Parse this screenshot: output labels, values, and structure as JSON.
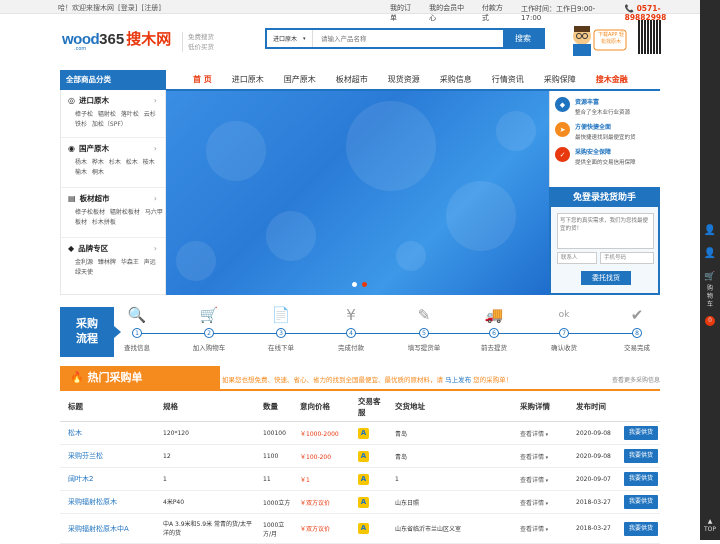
{
  "topbar": {
    "welcome": "哈！欢迎来搜木网",
    "login": "[登录]",
    "register": "[注册]",
    "links": [
      "我的订单",
      "我的会员中心",
      "付款方式",
      "工作时间：工作日9:00-17:00"
    ],
    "phone": "0571-89882998"
  },
  "logo": {
    "text_a": "wood",
    "text_b": "365",
    "text_cn": "搜木网",
    "sub": ".com"
  },
  "slogan": [
    "免费搜货",
    "低价买货"
  ],
  "search": {
    "category": "进口原木",
    "placeholder": "请输入产品名称",
    "button": "搜索"
  },
  "mascot": {
    "text": "下载APP 轻松找原木"
  },
  "nav": {
    "category_header": "全部商品分类",
    "items": [
      "首 页",
      "进口原木",
      "国产原木",
      "板材超市",
      "现货资源",
      "采购信息",
      "行情资讯",
      "采购保障",
      "搜木金融"
    ]
  },
  "categories": [
    {
      "title": "进口原木",
      "subs": "樟子松  辐射松  落叶松  云杉  铁杉  加松（SPF）"
    },
    {
      "title": "国产原木",
      "subs": "杨木  桦木  杉木  松木  桉木  榆木  桐木"
    },
    {
      "title": "板材超市",
      "subs": "樟子松板材  辐射松板材  马六甲板材  杉木拼板"
    },
    {
      "title": "品牌专区",
      "subs": "金利源  臻林牌  华森王  声远  绿天使"
    }
  ],
  "features": [
    {
      "title": "资源丰富",
      "desc": "整合了全木业行业资源",
      "color": "#1f73bf"
    },
    {
      "title": "方便快捷全面",
      "desc": "最快捷速找到最便宜的货",
      "color": "#f58a1f"
    },
    {
      "title": "采购安全保障",
      "desc": "提供全面的交易信用保障",
      "color": "#e8380d"
    }
  ],
  "helper": {
    "title": "免登录找货助手",
    "textarea_placeholder": "写下您的真实需求，我们为您找最便宜的货！",
    "contact_placeholder": "联系人",
    "phone_placeholder": "手机号码",
    "submit": "委托找货"
  },
  "process": {
    "title_a": "采购",
    "title_b": "流程",
    "steps": [
      {
        "n": "1",
        "label": "查找信息",
        "icon": "🔍"
      },
      {
        "n": "2",
        "label": "加入购物车",
        "icon": "🛒"
      },
      {
        "n": "3",
        "label": "在线下单",
        "icon": "📄"
      },
      {
        "n": "4",
        "label": "完成付款",
        "icon": "¥"
      },
      {
        "n": "5",
        "label": "填写提货单",
        "icon": "✎"
      },
      {
        "n": "6",
        "label": "前去提货",
        "icon": "🚚"
      },
      {
        "n": "7",
        "label": "确认收货",
        "icon": "ok"
      },
      {
        "n": "8",
        "label": "交易完成",
        "icon": "✔"
      }
    ]
  },
  "hot": {
    "title": "热门采购单",
    "message": "如果您也想免费、快速、省心、省力的找到全国最便宜、最优质的原材料，请",
    "message_link": "马上发布",
    "message_tail": "您的采购单！",
    "more": "查看更多采购信息"
  },
  "table": {
    "headers": [
      "标题",
      "规格",
      "数量",
      "意向价格",
      "交易客服",
      "交货地址",
      "采购详情",
      "发布时间",
      ""
    ],
    "detail_label": "查看详情",
    "button_label": "我要供货",
    "rows": [
      {
        "title": "松木",
        "spec": "120*120",
        "qty": "100100",
        "price": "￥1000-2000",
        "addr": "青岛",
        "date": "2020-09-08"
      },
      {
        "title": "采购芬兰松",
        "spec": "12",
        "qty": "1100",
        "price": "￥100-200",
        "addr": "青岛",
        "date": "2020-09-08"
      },
      {
        "title": "阔叶木2",
        "spec": "1",
        "qty": "11",
        "price": "￥1",
        "addr": "1",
        "date": "2020-09-07"
      },
      {
        "title": "采购辐射松原木",
        "spec": "4米P40",
        "qty": "1000立方",
        "price": "￥双方议价",
        "addr": "山东日照",
        "date": "2018-03-27"
      },
      {
        "title": "采购辐射松原木中A",
        "spec": "中A 3.9米和5.9米 常青的货/太平洋的货",
        "qty": "1000立方/月",
        "price": "￥双方议价",
        "addr": "山东省临沂市兰山区义室",
        "date": "2018-03-27"
      }
    ]
  },
  "sidebar": {
    "cart": "购物车",
    "cart_count": "0",
    "top": "TOP"
  }
}
